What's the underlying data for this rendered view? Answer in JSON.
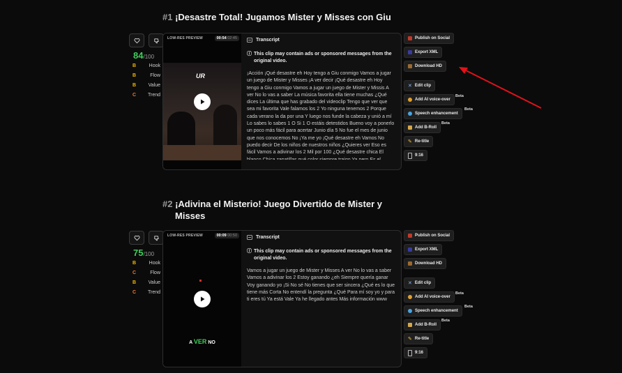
{
  "clips": [
    {
      "num": "#1",
      "title": "¡Desastre Total! Jugamos Mister y Misses con Giu",
      "score": "84",
      "score_max": "/100",
      "grades": [
        {
          "g": "B",
          "label": "Hook",
          "color": "#f2b705"
        },
        {
          "g": "B",
          "label": "Flow",
          "color": "#f2b705"
        },
        {
          "g": "B",
          "label": "Value",
          "color": "#f2b705"
        },
        {
          "g": "C",
          "label": "Trend",
          "color": "#f07a2c"
        }
      ],
      "preview_label": "LOW-RES PREVIEW",
      "time_current": "00:54",
      "time_total": "02:45",
      "transcript_label": "Transcript",
      "notice": "This clip may contain ads or sponsored messages from the original video.",
      "transcript": "¡Acción ¡Qué desastre eh Hoy tengo a Giu conmigo Vamos a jugar un juego de Mister y Misses ¡A ver decir ¡Qué desastre eh Hoy tengo a Giu conmigo Vamos a jugar un juego de Mister y Missis A ver No lo vas a saber La música favorita ella tiene muchas ¿Qué dices La última que has grabado del videoclip Tengo que ver que sea mi favorita Vale falamos los 2 Yo ninguna tenemos 2 Porque cada verano la da por una Y luego nos funde la cabeza y unió a mí Lo sabes lo sabes 1 O Si 1 O estáis detestidos Bueno voy a ponerlo un poco más fácil para acertar Junio día 5 No fue el mes de junio que nos conocemos No ¡Ya me yo ¡Qué desastre eh Vamos No puedo decir De los niños de nuestros niños ¿Quieres ver Eso es fácil Vamos a adivinar los 2 Mil por 100 ¿Qué desastre chica El blanco Chica zapatillas qué color siempre traigo Ya pero Es el"
    },
    {
      "num": "#2",
      "title": "¡Adivina el Misterio! Juego Divertido de Mister y Misses",
      "score": "75",
      "score_max": "/100",
      "grades": [
        {
          "g": "B",
          "label": "Hook",
          "color": "#f2b705"
        },
        {
          "g": "C",
          "label": "Flow",
          "color": "#f07a2c"
        },
        {
          "g": "B",
          "label": "Value",
          "color": "#f2b705"
        },
        {
          "g": "C",
          "label": "Trend",
          "color": "#f07a2c"
        }
      ],
      "preview_label": "LOW-RES PREVIEW",
      "time_current": "00:09",
      "time_total": "00:50",
      "transcript_label": "Transcript",
      "notice": "This clip may contain ads or sponsored messages from the original video.",
      "transcript": "Vamos a jugar un juego de Mister y Misses A ver No lo vas a saber Vamos a adivinar los 2 Estoy ganando ¿eh Siempre quería ganar Voy ganando yo ¡Si No sé No tienes que ser sincera ¿Qué es lo que tiene más Corta No entendí la pregunta ¿Qué Para mí soy yo y para ti eres tú Ya está Vale Ya he llegado antes Más información www",
      "caption_parts": [
        "A ",
        "VER",
        " NO"
      ]
    }
  ],
  "actions": [
    {
      "label": "Publish on Social",
      "icon": "calendar-icon",
      "color": "#c0392b"
    },
    {
      "label": "Export XML",
      "icon": "premiere-icon",
      "color": "#2a2a6a"
    },
    {
      "label": "Download HD",
      "icon": "download-icon",
      "color": "#7a5a2a"
    },
    {
      "label": "Edit clip",
      "icon": "scissors-icon",
      "color": "#8ab4f8"
    },
    {
      "label": "Add AI voice-over",
      "icon": "voice-icon",
      "color": "#e0a030"
    },
    {
      "label": "Speech enhancement",
      "icon": "mic-icon",
      "color": "#4aa3df"
    },
    {
      "label": "Add B-Roll",
      "icon": "film-icon",
      "color": "#d4a84a"
    },
    {
      "label": "Re-title",
      "icon": "pencil-icon",
      "color": "#f0c040"
    },
    {
      "label": "9:16",
      "icon": "aspect-icon",
      "color": "#bbbbbb"
    }
  ],
  "beta_label": "Beta",
  "accent_arrow": "#e0121a"
}
